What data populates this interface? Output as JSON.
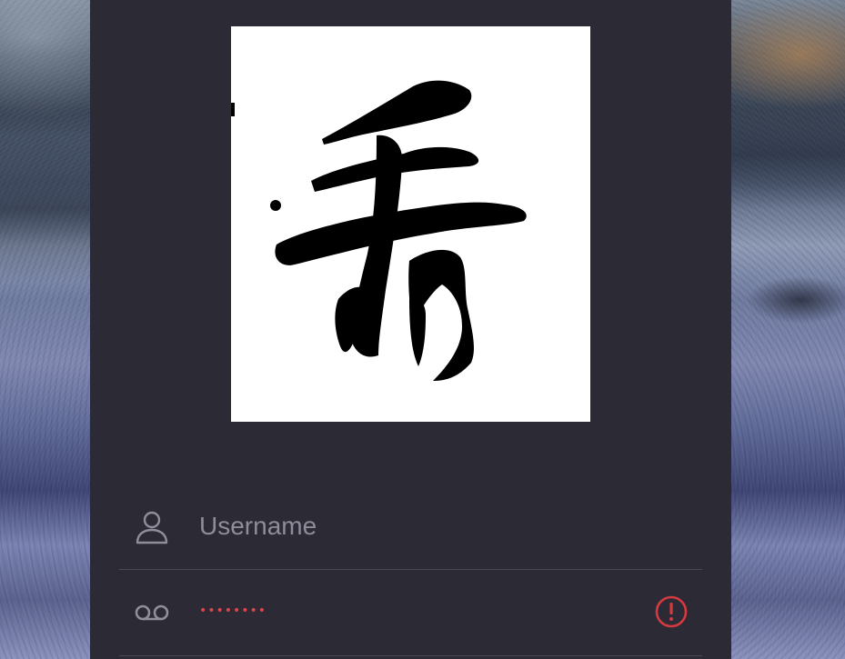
{
  "login": {
    "logo": {
      "icon": "calligraphy-logo",
      "background": "#ffffff"
    },
    "username": {
      "icon": "user-icon",
      "placeholder": "Username",
      "value": ""
    },
    "password": {
      "icon": "voicemail-icon",
      "masked_value": "••••••••",
      "status_icon": "error-icon",
      "status_color": "#d63a40"
    }
  },
  "colors": {
    "panel_bg": "#2b2a35",
    "divider": "#4a4a56",
    "placeholder_text": "#8e8d9a",
    "icon_gray": "#8f8e9b",
    "error_red": "#d63a40"
  }
}
